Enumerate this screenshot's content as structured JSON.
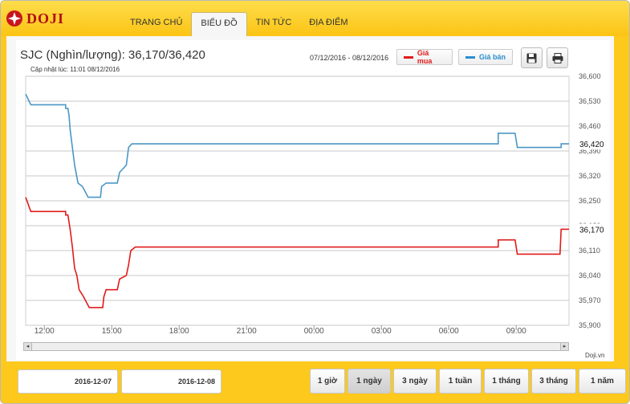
{
  "brand": {
    "name": "DOJI"
  },
  "nav": {
    "items": [
      "TRANG CHỦ",
      "BIỂU ĐỒ",
      "TIN TỨC",
      "ĐỊA ĐIỂM"
    ],
    "active": 1
  },
  "header": {
    "title": "SJC (Nghìn/lượng): 36,170/36,420",
    "updated": "Cập nhật lúc: 11:01 08/12/2016",
    "range": "07/12/2016 - 08/12/2016"
  },
  "legend": {
    "buy_label": "Giá mua",
    "sell_label": "Giá bán"
  },
  "colors": {
    "buy": "#e11b1b",
    "sell": "#4b97c6",
    "accent": "#fdc91c"
  },
  "icons": {
    "save": "floppy-disk-icon",
    "print": "printer-icon",
    "logo": "doji-logo-icon"
  },
  "chart_data": {
    "type": "line",
    "title": "SJC (Nghìn/lượng): 36,170/36,420",
    "x_ticks": [
      "12:00",
      "15:00",
      "18:00",
      "21:00",
      "00:00",
      "03:00",
      "06:00",
      "09:00"
    ],
    "y_ticks": [
      36600,
      36530,
      36460,
      36390,
      36320,
      36250,
      36180,
      36110,
      36040,
      35970,
      35900
    ],
    "ylim": [
      35900,
      36600
    ],
    "x_unit": "hours since 12:00 on 2016-12-07",
    "xlim": [
      -0.83,
      23.35
    ],
    "grid": true,
    "series": [
      {
        "name": "Giá bán",
        "step": true,
        "points": [
          [
            -0.83,
            36550
          ],
          [
            -0.6,
            36520
          ],
          [
            0.95,
            36520
          ],
          [
            0.95,
            36510
          ],
          [
            1.05,
            36510
          ],
          [
            1.1,
            36490
          ],
          [
            1.15,
            36450
          ],
          [
            1.25,
            36400
          ],
          [
            1.35,
            36350
          ],
          [
            1.5,
            36300
          ],
          [
            1.7,
            36290
          ],
          [
            1.95,
            36260
          ],
          [
            2.5,
            36260
          ],
          [
            2.55,
            36290
          ],
          [
            2.75,
            36300
          ],
          [
            3.25,
            36300
          ],
          [
            3.35,
            36330
          ],
          [
            3.65,
            36350
          ],
          [
            3.75,
            36400
          ],
          [
            3.9,
            36410
          ],
          [
            5.95,
            36410
          ],
          [
            20.2,
            36410
          ],
          [
            20.2,
            36440
          ],
          [
            20.95,
            36440
          ],
          [
            21.05,
            36400
          ],
          [
            23.0,
            36400
          ],
          [
            23.0,
            36410
          ],
          [
            23.35,
            36410
          ]
        ],
        "last_label": "36,420"
      },
      {
        "name": "Giá mua",
        "step": true,
        "points": [
          [
            -0.83,
            36260
          ],
          [
            -0.6,
            36220
          ],
          [
            0.95,
            36220
          ],
          [
            0.95,
            36210
          ],
          [
            1.05,
            36210
          ],
          [
            1.15,
            36170
          ],
          [
            1.25,
            36120
          ],
          [
            1.35,
            36060
          ],
          [
            1.45,
            36040
          ],
          [
            1.55,
            36000
          ],
          [
            1.75,
            35980
          ],
          [
            2.0,
            35950
          ],
          [
            2.6,
            35950
          ],
          [
            2.65,
            35980
          ],
          [
            2.75,
            36000
          ],
          [
            3.25,
            36000
          ],
          [
            3.35,
            36030
          ],
          [
            3.65,
            36040
          ],
          [
            3.75,
            36070
          ],
          [
            3.85,
            36110
          ],
          [
            4.05,
            36120
          ],
          [
            5.95,
            36120
          ],
          [
            20.2,
            36120
          ],
          [
            20.2,
            36140
          ],
          [
            20.95,
            36140
          ],
          [
            21.05,
            36100
          ],
          [
            22.95,
            36100
          ],
          [
            23.0,
            36170
          ],
          [
            23.35,
            36170
          ]
        ],
        "last_label": "36,170"
      }
    ]
  },
  "footer": {
    "date_from": "2016-12-07",
    "date_to": "2016-12-08",
    "ranges": [
      "1 giờ",
      "1 ngày",
      "3 ngày",
      "1 tuần",
      "1 tháng",
      "3 tháng",
      "1 năm"
    ],
    "active_range": 1,
    "credit": "Doji.vn"
  },
  "scrollbar": {
    "left_arrow": "◂",
    "right_arrow": "▸"
  }
}
